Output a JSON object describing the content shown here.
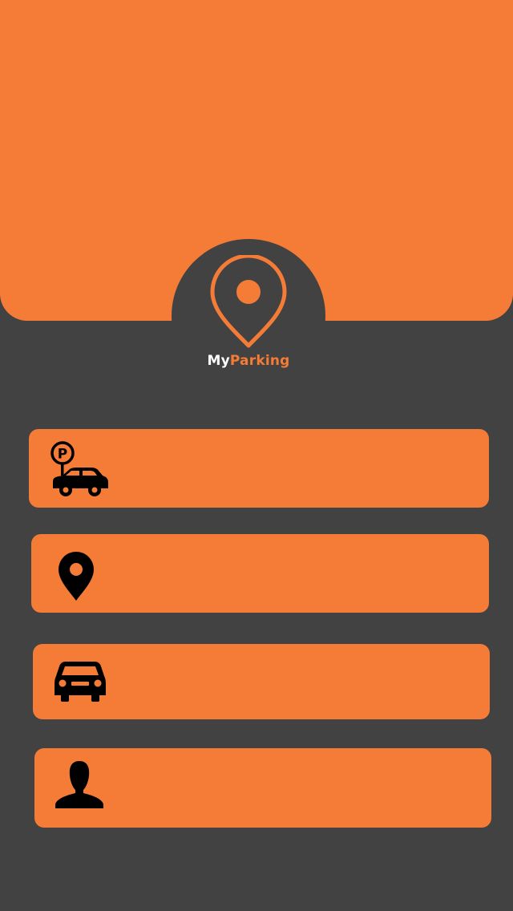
{
  "app": {
    "brand_part1": "My",
    "brand_part2": "Parking",
    "accent_color": "#f47c37",
    "background_color": "#424242"
  },
  "menu": [
    {
      "id": "parking",
      "icon": "parking-car-icon",
      "label": ""
    },
    {
      "id": "location",
      "icon": "map-pin-icon",
      "label": ""
    },
    {
      "id": "car",
      "icon": "car-icon",
      "label": ""
    },
    {
      "id": "profile",
      "icon": "user-icon",
      "label": ""
    }
  ]
}
